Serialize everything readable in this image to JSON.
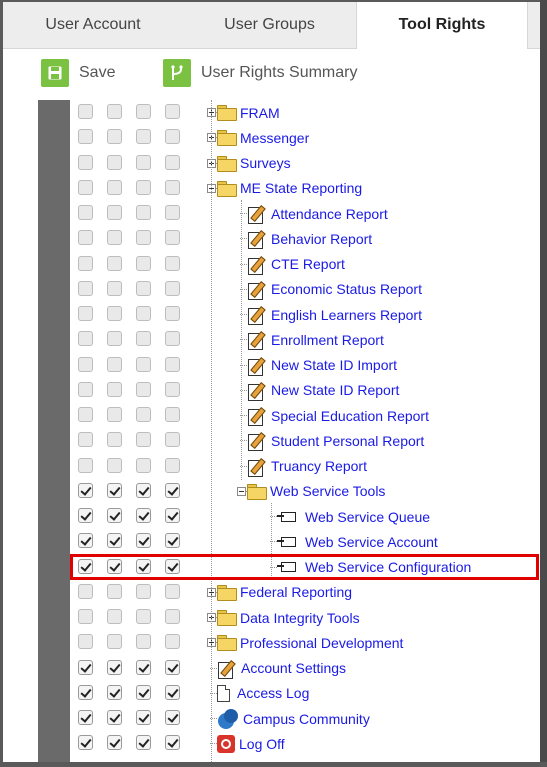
{
  "tabs": [
    {
      "label": "User Account",
      "active": false
    },
    {
      "label": "User Groups",
      "active": false
    },
    {
      "label": "Tool Rights",
      "active": true
    }
  ],
  "toolbar": {
    "save_label": "Save",
    "summary_label": "User Rights Summary",
    "accent": "#7cc242"
  },
  "tree": [
    {
      "label": "FRAM",
      "icon": "folder-icon",
      "level": 0,
      "expander": "plus",
      "checked": false
    },
    {
      "label": "Messenger",
      "icon": "folder-icon",
      "level": 0,
      "expander": "plus",
      "checked": false
    },
    {
      "label": "Surveys",
      "icon": "folder-icon",
      "level": 0,
      "expander": "plus",
      "checked": false
    },
    {
      "label": "ME State Reporting",
      "icon": "folder-icon",
      "level": 0,
      "expander": "minus",
      "checked": false
    },
    {
      "label": "Attendance Report",
      "icon": "report-icon",
      "level": 1,
      "checked": false
    },
    {
      "label": "Behavior Report",
      "icon": "report-icon",
      "level": 1,
      "checked": false
    },
    {
      "label": "CTE Report",
      "icon": "report-icon",
      "level": 1,
      "checked": false
    },
    {
      "label": "Economic Status Report",
      "icon": "report-icon",
      "level": 1,
      "checked": false
    },
    {
      "label": "English Learners Report",
      "icon": "report-icon",
      "level": 1,
      "checked": false
    },
    {
      "label": "Enrollment Report",
      "icon": "report-icon",
      "level": 1,
      "checked": false
    },
    {
      "label": "New State ID Import",
      "icon": "report-icon",
      "level": 1,
      "checked": false
    },
    {
      "label": "New State ID Report",
      "icon": "report-icon",
      "level": 1,
      "checked": false
    },
    {
      "label": "Special Education Report",
      "icon": "report-icon",
      "level": 1,
      "checked": false
    },
    {
      "label": "Student Personal Report",
      "icon": "report-icon",
      "level": 1,
      "checked": false
    },
    {
      "label": "Truancy Report",
      "icon": "report-icon",
      "level": 1,
      "checked": false
    },
    {
      "label": "Web Service Tools",
      "icon": "folder-icon",
      "level": 1,
      "expander": "minus",
      "checked": true
    },
    {
      "label": "Web Service Queue",
      "icon": "web-service-icon",
      "level": 2,
      "checked": true
    },
    {
      "label": "Web Service Account",
      "icon": "web-service-icon",
      "level": 2,
      "checked": true
    },
    {
      "label": "Web Service Configuration",
      "icon": "web-service-icon",
      "level": 2,
      "checked": true,
      "highlighted": true
    },
    {
      "label": "Federal Reporting",
      "icon": "folder-icon",
      "level": 0,
      "expander": "plus",
      "checked": false
    },
    {
      "label": "Data Integrity Tools",
      "icon": "folder-icon",
      "level": 0,
      "expander": "plus",
      "checked": false
    },
    {
      "label": "Professional Development",
      "icon": "folder-icon",
      "level": 0,
      "expander": "plus",
      "checked": false
    },
    {
      "label": "Account Settings",
      "icon": "report-icon",
      "level": 0,
      "checked": true
    },
    {
      "label": "Access Log",
      "icon": "document-icon",
      "level": 0,
      "checked": true
    },
    {
      "label": "Campus Community",
      "icon": "community-icon",
      "level": 0,
      "checked": true
    },
    {
      "label": "Log Off",
      "icon": "logoff-icon",
      "level": 0,
      "checked": true
    }
  ],
  "colors": {
    "link": "#1a1ae6",
    "highlight": "#e00000"
  }
}
